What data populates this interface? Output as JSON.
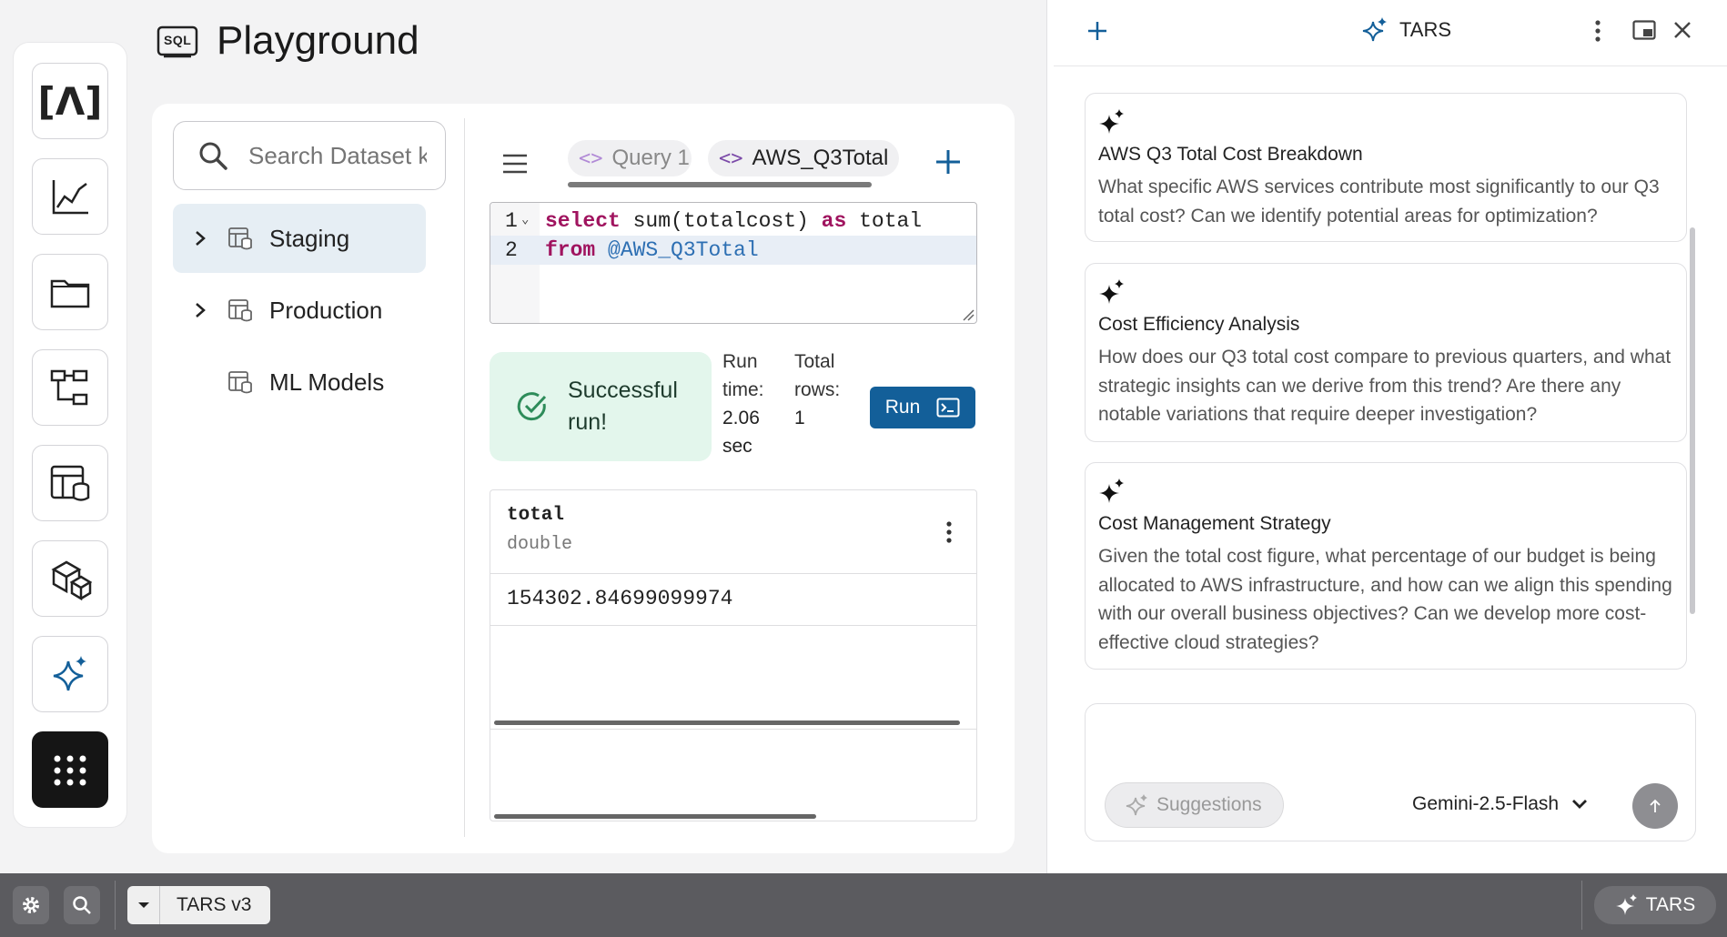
{
  "header": {
    "sql_badge": "SQL",
    "title": "Playground"
  },
  "rail": {
    "items": [
      {
        "icon": "lambda-logo-icon",
        "label": "[Λ]"
      },
      {
        "icon": "chart-icon"
      },
      {
        "icon": "folder-icon"
      },
      {
        "icon": "workflow-icon"
      },
      {
        "icon": "table-database-icon"
      },
      {
        "icon": "cubes-icon"
      },
      {
        "icon": "sparkle-icon"
      },
      {
        "icon": "apps-grid-icon"
      }
    ]
  },
  "sidebar": {
    "search_placeholder": "Search Dataset k",
    "tree": [
      {
        "label": "Staging",
        "expandable": true,
        "selected": true
      },
      {
        "label": "Production",
        "expandable": true,
        "selected": false
      },
      {
        "label": "ML Models",
        "expandable": false,
        "selected": false
      }
    ]
  },
  "editor": {
    "tabs": [
      {
        "label": "Query 1",
        "active": false
      },
      {
        "label": "AWS_Q3Total",
        "active": true
      }
    ],
    "lines": [
      {
        "num": "1",
        "kw1": "select",
        "text1": " sum(totalcost) ",
        "kw2": "as",
        "text2": " total"
      },
      {
        "num": "2",
        "kw1": "from",
        "ref": " @AWS_Q3Total"
      }
    ]
  },
  "status": {
    "text": "Successful run!",
    "run_time_label": "Run time:",
    "run_time_value": "2.06 sec",
    "rows_label": "Total rows:",
    "rows_value": "1",
    "run_button": "Run"
  },
  "results": {
    "column": {
      "name": "total",
      "type": "double"
    },
    "rows": [
      "154302.84699099974"
    ]
  },
  "assistant": {
    "title": "TARS",
    "suggestions": [
      {
        "title": "AWS Q3 Total Cost Breakdown",
        "body": "What specific AWS services contribute most significantly to our Q3 total cost? Can we identify potential areas for optimization?"
      },
      {
        "title": "Cost Efficiency Analysis",
        "body": "How does our Q3 total cost compare to previous quarters, and what strategic insights can we derive from this trend? Are there any notable variations that require deeper investigation?"
      },
      {
        "title": "Cost Management Strategy",
        "body": "Given the total cost figure, what percentage of our budget is being allocated to AWS infrastructure, and how can we align this spending with our overall business objectives? Can we develop more cost-effective cloud strategies?"
      }
    ],
    "suggestions_button": "Suggestions",
    "model": "Gemini-2.5-Flash"
  },
  "taskbar": {
    "app_label": "TARS v3",
    "right_label": "TARS"
  },
  "colors": {
    "accent": "#135f99",
    "success_bg": "#e3f6ec",
    "keyword": "#a0145f",
    "reference": "#2d6fb3"
  }
}
